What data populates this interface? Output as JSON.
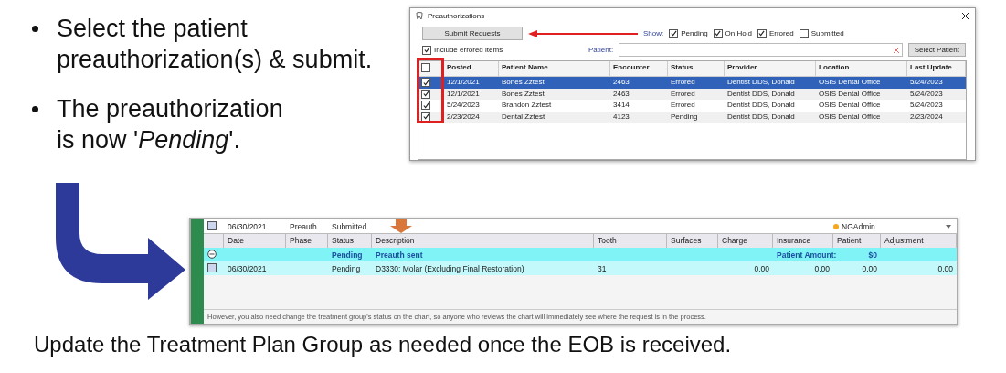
{
  "bullets": [
    {
      "text": "Select the patient preauthorization(s) & submit."
    },
    {
      "text": "The preauthorization is now '*Pending*'."
    }
  ],
  "preauth_window": {
    "title": "Preauthorizations",
    "submit_button": "Submit Requests",
    "include_errored": {
      "label": "Include errored items",
      "checked": true
    },
    "show_label": "Show:",
    "filters": [
      {
        "label": "Pending",
        "checked": true
      },
      {
        "label": "On Hold",
        "checked": true
      },
      {
        "label": "Errored",
        "checked": true
      },
      {
        "label": "Submitted",
        "checked": false
      }
    ],
    "patient_label": "Patient:",
    "select_button": "Select Patient",
    "table": {
      "select_all": {
        "checked": false
      },
      "columns": [
        "Posted",
        "Patient Name",
        "Encounter",
        "Status",
        "Provider",
        "Location",
        "Last Update"
      ],
      "rows": [
        {
          "checked": true,
          "selected": true,
          "cells": [
            "12/1/2021",
            "Bones Zztest",
            "2463",
            "Errored",
            "Dentist DDS, Donald",
            "OSIS Dental Office",
            "5/24/2023"
          ]
        },
        {
          "checked": true,
          "selected": false,
          "cells": [
            "12/1/2021",
            "Bones Zztest",
            "2463",
            "Errored",
            "Dentist DDS, Donald",
            "OSIS Dental Office",
            "5/24/2023"
          ]
        },
        {
          "checked": true,
          "selected": false,
          "cells": [
            "5/24/2023",
            "Brandon Zztest",
            "3414",
            "Errored",
            "Dentist DDS, Donald",
            "OSIS Dental Office",
            "5/24/2023"
          ]
        },
        {
          "checked": true,
          "selected": false,
          "cells": [
            "2/23/2024",
            "Dental Zztest",
            "4123",
            "Pending",
            "Dentist DDS, Donald",
            "OSIS Dental Office",
            "2/23/2024"
          ]
        }
      ]
    }
  },
  "treatment_plan": {
    "header_row": {
      "checked": false,
      "date": "06/30/2021",
      "phase": "Preauth",
      "status": "Submitted",
      "user": {
        "name": "NGAdmin",
        "color": "#f5a623"
      }
    },
    "columns": [
      "Date",
      "Phase",
      "Status",
      "Description",
      "Tooth",
      "Surfaces",
      "Charge",
      "Insurance",
      "Patient",
      "Adjustment"
    ],
    "group_row": {
      "expanded": true,
      "status": "Pending",
      "description": "Preauth sent",
      "amount_label": "Patient Amount:",
      "amount": "$0"
    },
    "lines": [
      {
        "checked": false,
        "date": "06/30/2021",
        "status": "Pending",
        "description": "D3330: Molar (Excluding Final Restoration)",
        "tooth": "31",
        "charge": "0.00",
        "insurance": "0.00",
        "patient": "0.00",
        "adjustment": "0.00"
      }
    ],
    "note": "However, you also need change the treatment group's status on the chart, so anyone who reviews the chart will immediately see where the request is in the process."
  },
  "caption": "Update the Treatment Plan Group as needed once the EOB is received."
}
